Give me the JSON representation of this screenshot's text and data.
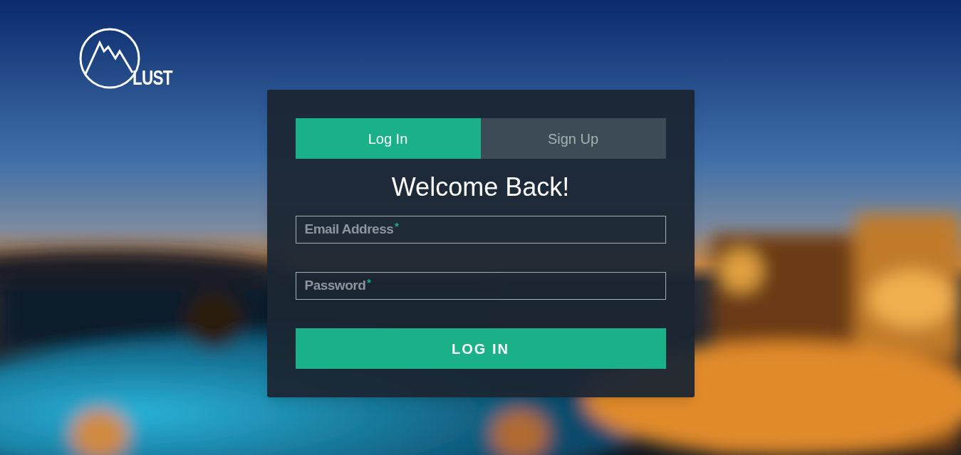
{
  "logo": {
    "text": "LUST"
  },
  "tabs": [
    {
      "label": "Log In",
      "selected": true
    },
    {
      "label": "Sign Up",
      "selected": false
    }
  ],
  "title": "Welcome Back!",
  "fields": [
    {
      "label": "Email Address",
      "required_mark": "*"
    },
    {
      "label": "Password",
      "required_mark": "*"
    }
  ],
  "submit": {
    "label": "LOG IN"
  }
}
